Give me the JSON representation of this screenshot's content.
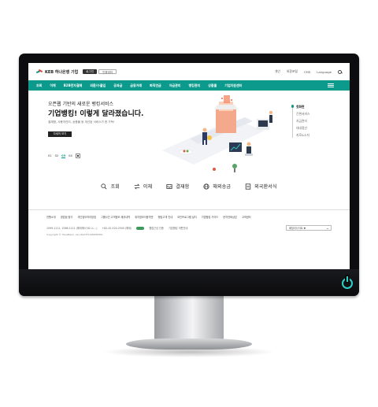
{
  "topbar": {
    "logo": "KEB 하나은행 기업",
    "login": "로그인",
    "cert": "인증센터",
    "links": [
      "개인",
      "외환포털",
      "CMS",
      "Language"
    ]
  },
  "nav": [
    "조회",
    "이체",
    "B2B전자결제",
    "외환/수출입",
    "공과금",
    "금융거래",
    "퇴직연금",
    "자금관리",
    "뱅킹관리",
    "상품몰",
    "기업지원센터"
  ],
  "hero": {
    "sub": "오픈웹 기반의 새로운 뱅킹서비스",
    "title": "기업뱅킹! 이렇게 달라졌습니다.",
    "desc": "결재함, 사용자관리, 상품몰 등 개선된 서비스가 한 가득!",
    "button": "자세히 보기",
    "pages": [
      "01",
      "02",
      "03",
      "04"
    ]
  },
  "side": [
    "첫화면",
    "간편서비스",
    "자금관리",
    "대내정산",
    "지로&소지"
  ],
  "quick": [
    {
      "label": "조회",
      "icon": "search-icon"
    },
    {
      "label": "이체",
      "icon": "transfer-icon"
    },
    {
      "label": "결재함",
      "icon": "inbox-icon"
    },
    {
      "label": "해외송금",
      "icon": "globe-icon"
    },
    {
      "label": "외국환서식",
      "icon": "document-icon"
    }
  ],
  "footer": {
    "links": [
      "전행소개",
      "영업점 찾기",
      "개인정보처리방침",
      "그룹사간 고객정보 제공내역",
      "위치정보이용약관",
      "뱅킹고객 안내",
      "보안프로그램 설치",
      "기업뱅킹 가이드",
      "문자전화상담",
      "고객센터"
    ],
    "phone": "1599-1111, 1588-1111 (해외에서 82-1-...)",
    "contact": "+82-42-520-2500 (해외)",
    "cert": "웹접근성 인증",
    "site": "기업뱅킹 개편안내",
    "select": "패밀리사이트 ▼",
    "copyright": "Copyright © HanaBank. ALL RIGHTS RESERVED."
  }
}
